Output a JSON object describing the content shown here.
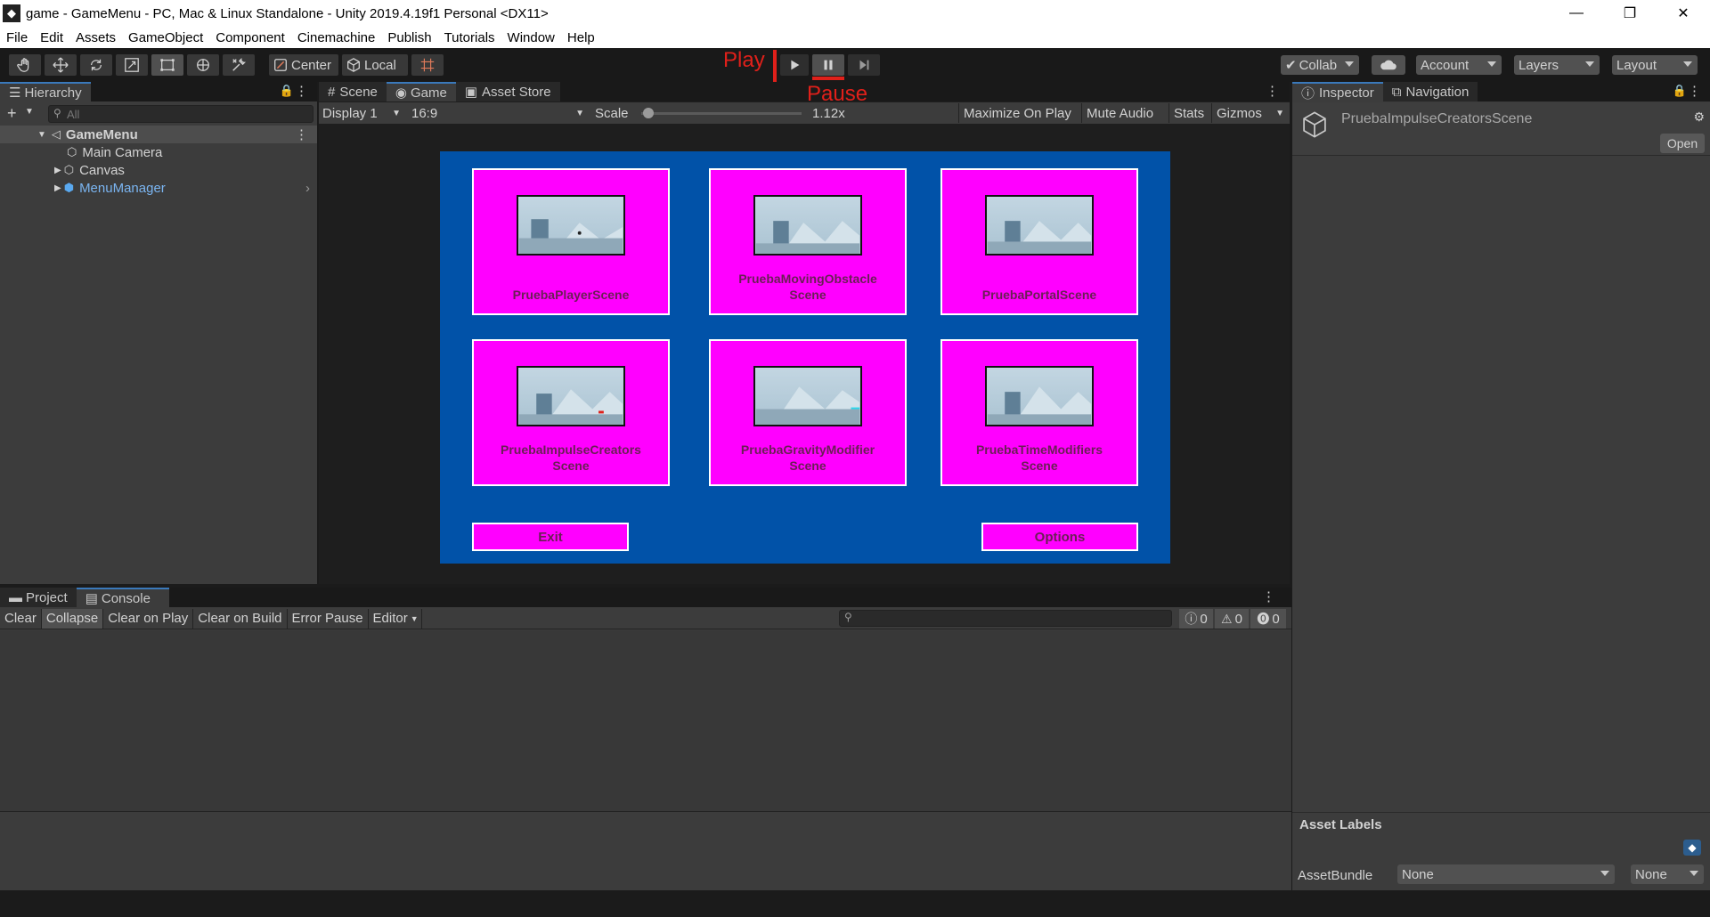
{
  "window": {
    "title": "game - GameMenu - PC, Mac & Linux Standalone - Unity 2019.4.19f1 Personal <DX11>",
    "app_icon": "unity-icon"
  },
  "window_controls": [
    "—",
    "❐",
    "✕"
  ],
  "menu": [
    "File",
    "Edit",
    "Assets",
    "GameObject",
    "Component",
    "Cinemachine",
    "Publish",
    "Tutorials",
    "Window",
    "Help"
  ],
  "toolbar": {
    "center_label": "Center",
    "local_label": "Local",
    "collab_label": "Collab",
    "account_label": "Account",
    "layers_label": "Layers",
    "layout_label": "Layout"
  },
  "annotations": {
    "play": "Play",
    "pause": "Pause"
  },
  "hierarchy": {
    "tab": "Hierarchy",
    "search_placeholder": "All",
    "items": [
      {
        "label": "GameMenu"
      },
      {
        "label": "Main Camera"
      },
      {
        "label": "Canvas"
      },
      {
        "label": "MenuManager"
      }
    ]
  },
  "game_panel": {
    "tabs": [
      "Scene",
      "Game",
      "Asset Store"
    ],
    "display": "Display 1",
    "aspect": "16:9",
    "scale_label": "Scale",
    "scale_value": "1.12x",
    "buttons": [
      "Maximize On Play",
      "Mute Audio",
      "Stats",
      "Gizmos"
    ],
    "cards": [
      {
        "l1": "PruebaPlayerScene",
        "l2": ""
      },
      {
        "l1": "PruebaMovingObstacle",
        "l2": "Scene"
      },
      {
        "l1": "PruebaPortalScene",
        "l2": ""
      },
      {
        "l1": "PruebaImpulseCreators",
        "l2": "Scene"
      },
      {
        "l1": "PruebaGravityModifier",
        "l2": "Scene"
      },
      {
        "l1": "PruebaTimeModifiers",
        "l2": "Scene"
      }
    ],
    "exit_label": "Exit",
    "options_label": "Options",
    "colors": {
      "background": "#0152a8",
      "card": "#ff00ff",
      "text": "#6a1f55"
    }
  },
  "console_panel": {
    "tabs": [
      "Project",
      "Console"
    ],
    "buttons": [
      "Clear",
      "Collapse",
      "Clear on Play",
      "Clear on Build",
      "Error Pause",
      "Editor"
    ],
    "counts": {
      "info": "0",
      "warning": "0",
      "error": "0"
    }
  },
  "inspector": {
    "tabs": [
      "Inspector",
      "Navigation"
    ],
    "asset_name": "PruebaImpulseCreatorsScene",
    "open_label": "Open",
    "asset_labels_title": "Asset Labels",
    "asset_bundle_label": "AssetBundle",
    "asset_bundle_value": "None",
    "asset_bundle_variant": "None"
  }
}
